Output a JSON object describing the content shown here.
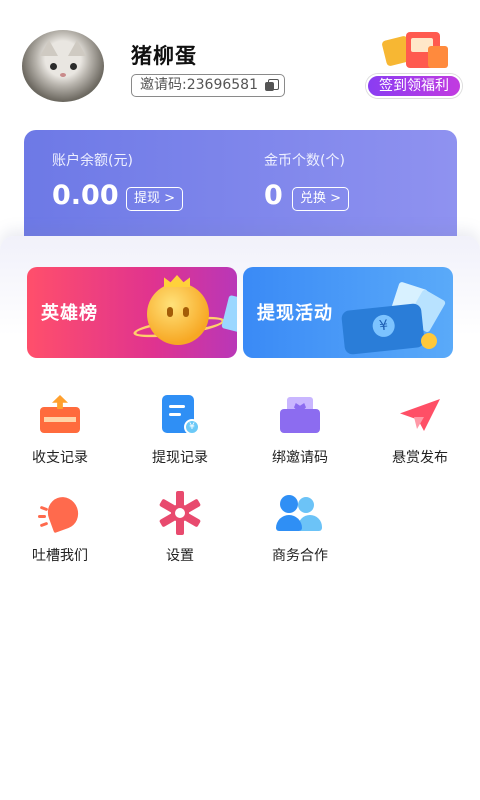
{
  "profile": {
    "username": "猪柳蛋",
    "invite_code_text": "邀请码:23696581"
  },
  "signin_badge": "签到领福利",
  "wallet": {
    "balance_label": "账户余额(元)",
    "balance_value": "0.00",
    "withdraw_button": "提现 >",
    "coins_label": "金币个数(个)",
    "coins_value": "0",
    "exchange_button": "兑换 >"
  },
  "banners": [
    {
      "title": "英雄榜"
    },
    {
      "title": "提现活动"
    }
  ],
  "menu": [
    {
      "label": "收支记录",
      "icon": "income-expense-icon"
    },
    {
      "label": "提现记录",
      "icon": "withdraw-record-icon"
    },
    {
      "label": "绑邀请码",
      "icon": "bind-invite-icon"
    },
    {
      "label": "悬赏发布",
      "icon": "reward-publish-icon"
    },
    {
      "label": "吐槽我们",
      "icon": "feedback-icon"
    },
    {
      "label": "设置",
      "icon": "settings-icon"
    },
    {
      "label": "商务合作",
      "icon": "business-icon"
    }
  ],
  "colors": {
    "wallet_gradient_start": "#6d79e6",
    "wallet_gradient_end": "#8f92f0",
    "signin_gradient_start": "#8a3df2",
    "signin_gradient_end": "#c23be0"
  }
}
